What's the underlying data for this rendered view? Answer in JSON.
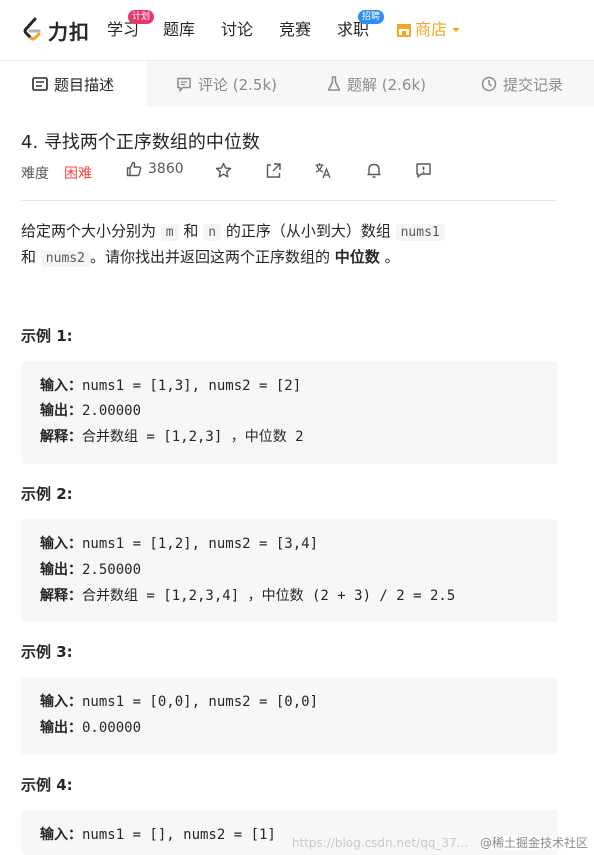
{
  "nav": {
    "logo_text": "力扣",
    "items": [
      {
        "label": "学习",
        "badge": "计划"
      },
      {
        "label": "题库"
      },
      {
        "label": "讨论"
      },
      {
        "label": "竞赛"
      },
      {
        "label": "求职",
        "badge": "招聘"
      }
    ],
    "store": "商店",
    "store_color": "#f5a623"
  },
  "tabs": [
    {
      "label": "题目描述",
      "icon": "description-icon",
      "active": true
    },
    {
      "label": "评论 (2.5k)",
      "icon": "comment-icon"
    },
    {
      "label": "题解 (2.6k)",
      "icon": "flask-icon"
    },
    {
      "label": "提交记录",
      "icon": "history-icon"
    }
  ],
  "problem": {
    "title": "4. 寻找两个正序数组的中位数",
    "difficulty_label": "难度",
    "difficulty": "困难",
    "difficulty_color": "#ef4743",
    "likes": "3860",
    "action_icons": [
      "star-icon",
      "share-icon",
      "translate-icon",
      "bell-icon",
      "feedback-icon"
    ]
  },
  "description": {
    "p1": "给定两个大小分别为",
    "m": "m",
    "and1": "和",
    "n": "n",
    "p2": "的正序（从小到大）数组",
    "nums1": "nums1",
    "and2": "和",
    "nums2": "nums2",
    "p3": "。请你找出并返回这两个正序数组的",
    "median": "中位数",
    "p4": "。"
  },
  "examples": [
    {
      "title": "示例 1:",
      "lines": [
        {
          "label": "输入：",
          "text": "nums1 = [1,3], nums2 = [2]"
        },
        {
          "label": "输出：",
          "text": "2.00000"
        },
        {
          "label": "解释：",
          "text": "合并数组 = [1,2,3] ，中位数 2"
        }
      ]
    },
    {
      "title": "示例 2:",
      "lines": [
        {
          "label": "输入：",
          "text": "nums1 = [1,2], nums2 = [3,4]"
        },
        {
          "label": "输出：",
          "text": "2.50000"
        },
        {
          "label": "解释：",
          "text": "合并数组 = [1,2,3,4] ，中位数 (2 + 3) / 2 = 2.5"
        }
      ]
    },
    {
      "title": "示例 3:",
      "lines": [
        {
          "label": "输入：",
          "text": "nums1 = [0,0], nums2 = [0,0]"
        },
        {
          "label": "输出：",
          "text": "0.00000"
        }
      ]
    },
    {
      "title": "示例 4:",
      "lines": [
        {
          "label": "输入：",
          "text": "nums1 = [], nums2 = [1]"
        }
      ]
    }
  ],
  "watermark": {
    "url": "https://blog.csdn.net/qq_37...",
    "brand": "@稀土掘金技术社区"
  }
}
